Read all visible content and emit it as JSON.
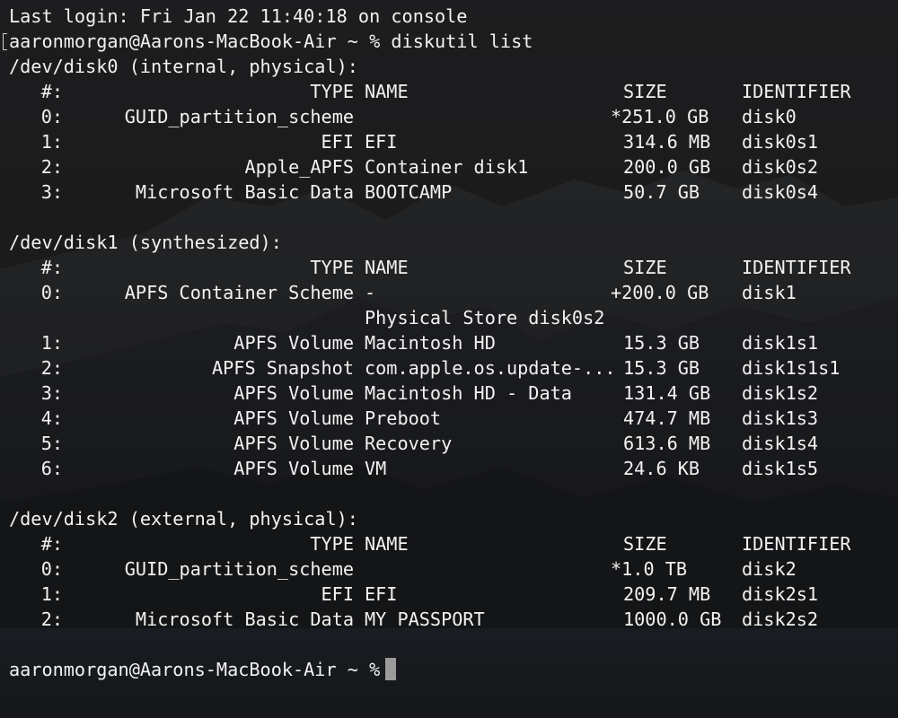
{
  "terminal": {
    "lines": [
      {
        "kind": "text",
        "text": "Last login: Fri Jan 22 11:40:18 on console"
      },
      {
        "kind": "text",
        "text": "aaronmorgan@Aarons-MacBook-Air ~ % diskutil list"
      },
      {
        "kind": "text",
        "text": "/dev/disk0 (internal, physical):"
      },
      {
        "kind": "row",
        "num": "#:",
        "type": "TYPE",
        "name": "NAME",
        "size": "SIZE",
        "id": "IDENTIFIER"
      },
      {
        "kind": "row",
        "num": "0:",
        "type": "GUID_partition_scheme",
        "name": "",
        "size": "*251.0 GB",
        "id": "disk0"
      },
      {
        "kind": "row",
        "num": "1:",
        "type": "EFI",
        "name": "EFI",
        "size": "314.6 MB",
        "id": "disk0s1"
      },
      {
        "kind": "row",
        "num": "2:",
        "type": "Apple_APFS",
        "name": "Container disk1",
        "size": "200.0 GB",
        "id": "disk0s2"
      },
      {
        "kind": "row",
        "num": "3:",
        "type": "Microsoft Basic Data",
        "name": "BOOTCAMP",
        "size": "50.7 GB",
        "id": "disk0s4"
      },
      {
        "kind": "blank"
      },
      {
        "kind": "text",
        "text": "/dev/disk1 (synthesized):"
      },
      {
        "kind": "row",
        "num": "#:",
        "type": "TYPE",
        "name": "NAME",
        "size": "SIZE",
        "id": "IDENTIFIER"
      },
      {
        "kind": "row",
        "num": "0:",
        "type": "APFS Container Scheme",
        "name": "-",
        "size": "+200.0 GB",
        "id": "disk1"
      },
      {
        "kind": "row",
        "num": "",
        "type": "",
        "name": "Physical Store disk0s2",
        "size": "",
        "id": ""
      },
      {
        "kind": "row",
        "num": "1:",
        "type": "APFS Volume",
        "name": "Macintosh HD",
        "size": "15.3 GB",
        "id": "disk1s1"
      },
      {
        "kind": "row",
        "num": "2:",
        "type": "APFS Snapshot",
        "name": "com.apple.os.update-...",
        "size": "15.3 GB",
        "id": "disk1s1s1"
      },
      {
        "kind": "row",
        "num": "3:",
        "type": "APFS Volume",
        "name": "Macintosh HD - Data",
        "size": "131.4 GB",
        "id": "disk1s2"
      },
      {
        "kind": "row",
        "num": "4:",
        "type": "APFS Volume",
        "name": "Preboot",
        "size": "474.7 MB",
        "id": "disk1s3"
      },
      {
        "kind": "row",
        "num": "5:",
        "type": "APFS Volume",
        "name": "Recovery",
        "size": "613.6 MB",
        "id": "disk1s4"
      },
      {
        "kind": "row",
        "num": "6:",
        "type": "APFS Volume",
        "name": "VM",
        "size": "24.6 KB",
        "id": "disk1s5"
      },
      {
        "kind": "blank"
      },
      {
        "kind": "text",
        "text": "/dev/disk2 (external, physical):"
      },
      {
        "kind": "row",
        "num": "#:",
        "type": "TYPE",
        "name": "NAME",
        "size": "SIZE",
        "id": "IDENTIFIER"
      },
      {
        "kind": "row",
        "num": "0:",
        "type": "GUID_partition_scheme",
        "name": "",
        "size": "*1.0 TB",
        "id": "disk2"
      },
      {
        "kind": "row",
        "num": "1:",
        "type": "EFI",
        "name": "EFI",
        "size": "209.7 MB",
        "id": "disk2s1"
      },
      {
        "kind": "row",
        "num": "2:",
        "type": "Microsoft Basic Data",
        "name": "MY PASSPORT",
        "size": "1000.0 GB",
        "id": "disk2s2"
      },
      {
        "kind": "blank"
      },
      {
        "kind": "text",
        "text": "aaronmorgan@Aarons-MacBook-Air ~ % "
      }
    ],
    "colors": {
      "text": "#f2f2f2",
      "cursor": "#9a9a9a",
      "background": "#151515"
    }
  }
}
